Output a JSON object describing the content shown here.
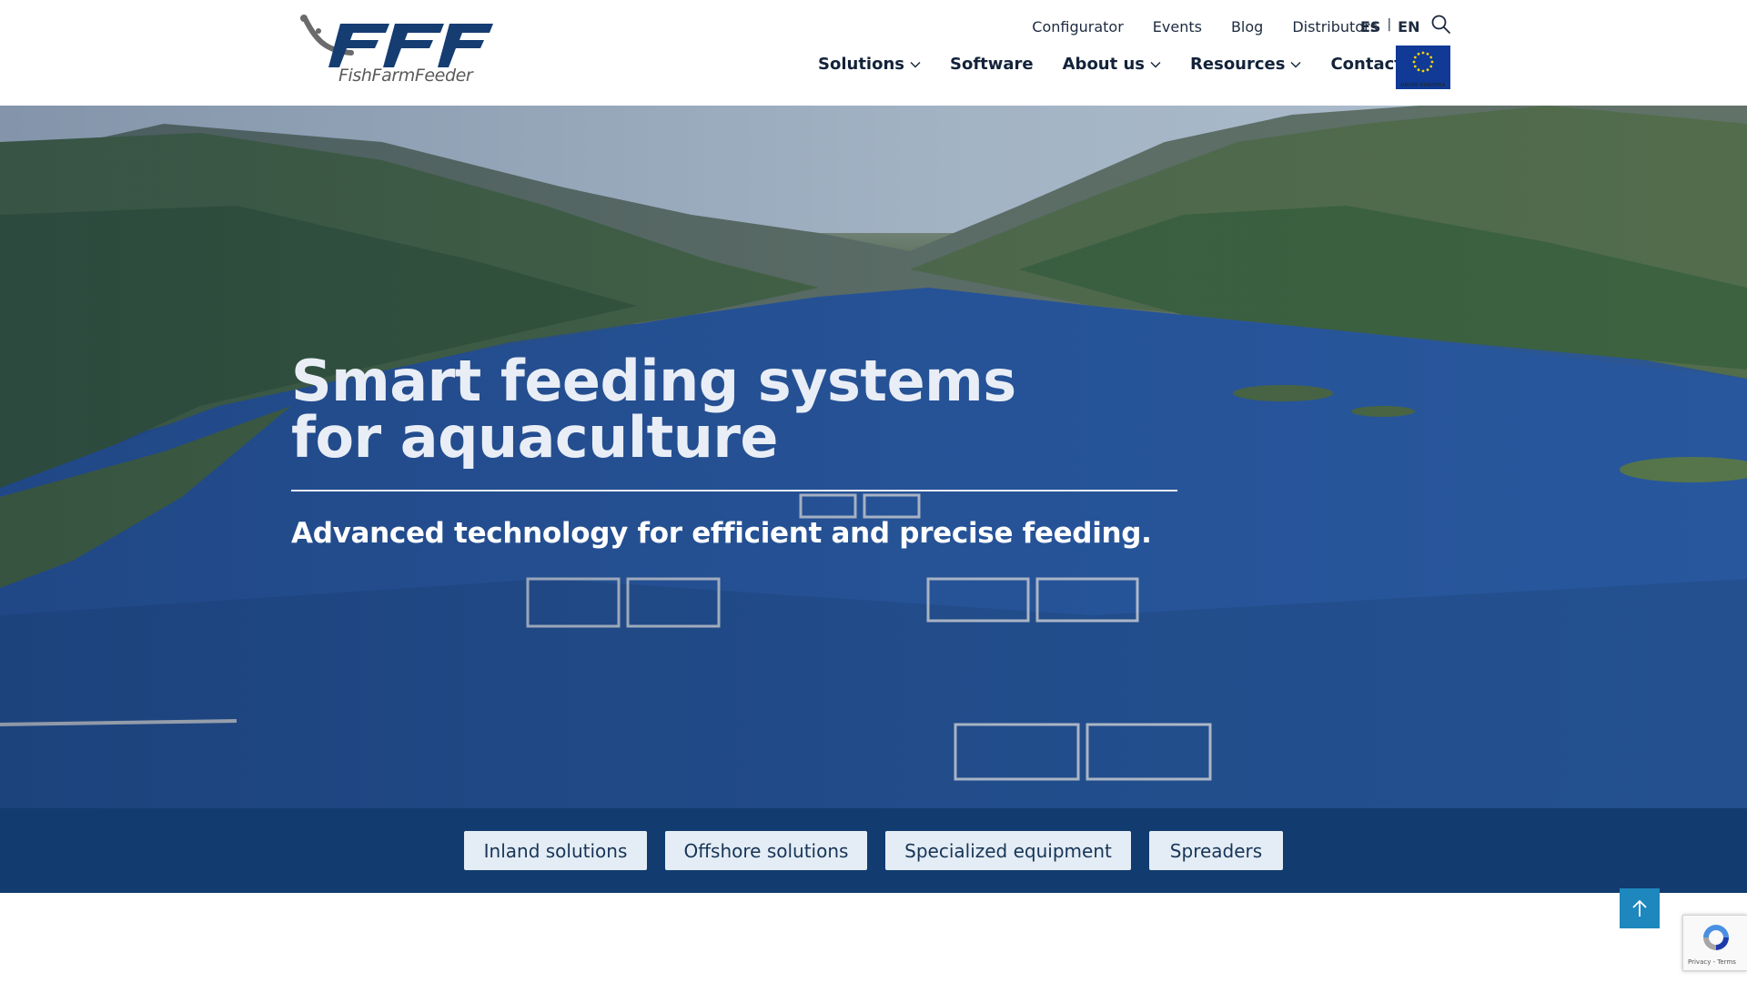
{
  "brand": {
    "logo_letters": "FFF",
    "logo_text": "FishFarmFeeder",
    "brand_color": "#123c6f"
  },
  "top_nav": {
    "items": [
      {
        "label": "Configurator"
      },
      {
        "label": "Events"
      },
      {
        "label": "Blog"
      },
      {
        "label": "Distributors"
      }
    ]
  },
  "language": {
    "options": [
      "ES",
      "EN"
    ],
    "separator": "|"
  },
  "main_nav": {
    "items": [
      {
        "label": "Solutions",
        "has_dropdown": true
      },
      {
        "label": "Software",
        "has_dropdown": false
      },
      {
        "label": "About us",
        "has_dropdown": true
      },
      {
        "label": "Resources",
        "has_dropdown": true
      },
      {
        "label": "Contact",
        "has_dropdown": false
      }
    ]
  },
  "eu_badge": {
    "label": "UNIÓN EUROPEA"
  },
  "hero": {
    "title": "Smart feeding systems for aquaculture",
    "subtitle": "Advanced technology for efficient and precise feeding."
  },
  "solutions_bar": {
    "buttons": [
      {
        "label": "Inland solutions"
      },
      {
        "label": "Offshore solutions"
      },
      {
        "label": "Specialized equipment"
      },
      {
        "label": "Spreaders"
      }
    ]
  },
  "recaptcha": {
    "links": "Privacy - Terms"
  },
  "icons": {
    "search": "search-icon",
    "chevron": "chevron-down-icon",
    "back_to_top": "arrow-up-icon",
    "recaptcha": "recaptcha-icon"
  }
}
